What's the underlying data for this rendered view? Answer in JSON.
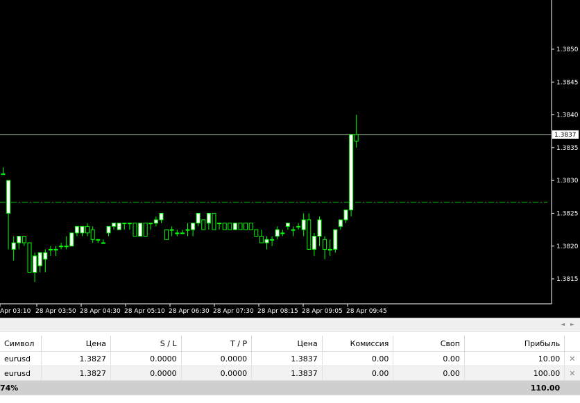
{
  "chart_data": {
    "type": "candlestick",
    "symbol": "eurusd",
    "ylim": [
      1.38112,
      1.38575
    ],
    "price_ticks": [
      "1.3815",
      "1.3820",
      "1.3825",
      "1.3830",
      "1.3835",
      "1.3840"
    ],
    "top_partial_tick": "1.3850",
    "second_tick": "1.3845",
    "current_price": "1.3837",
    "current_price_value": 1.3837,
    "open_price_value": 1.38267,
    "time_labels": [
      "Apr 03:10",
      "28 Apr 03:50",
      "28 Apr 04:30",
      "28 Apr 05:10",
      "28 Apr 06:30",
      "28 Apr 07:30",
      "28 Apr 08:15",
      "28 Apr 09:05",
      "28 Apr 09:45"
    ],
    "bull_color": "#ffffff",
    "wick_color": "#00ff00",
    "candles": [
      {
        "o": 1.3831,
        "h": 1.3832,
        "l": 1.3831,
        "c": 1.3831
      },
      {
        "o": 1.3825,
        "h": 1.383,
        "l": 1.38195,
        "c": 1.383
      },
      {
        "o": 1.38195,
        "h": 1.38215,
        "l": 1.38178,
        "c": 1.38205
      },
      {
        "o": 1.38205,
        "h": 1.38215,
        "l": 1.38195,
        "c": 1.38215
      },
      {
        "o": 1.38215,
        "h": 1.38215,
        "l": 1.382,
        "c": 1.38205
      },
      {
        "o": 1.38205,
        "h": 1.38205,
        "l": 1.3816,
        "c": 1.3816
      },
      {
        "o": 1.3816,
        "h": 1.3819,
        "l": 1.38145,
        "c": 1.38185
      },
      {
        "o": 1.3817,
        "h": 1.3819,
        "l": 1.3816,
        "c": 1.3819
      },
      {
        "o": 1.3818,
        "h": 1.38195,
        "l": 1.3816,
        "c": 1.3819
      },
      {
        "o": 1.38195,
        "h": 1.382,
        "l": 1.38185,
        "c": 1.38195
      },
      {
        "o": 1.38195,
        "h": 1.382,
        "l": 1.38185,
        "c": 1.38195
      },
      {
        "o": 1.382,
        "h": 1.38205,
        "l": 1.38195,
        "c": 1.382
      },
      {
        "o": 1.382,
        "h": 1.38215,
        "l": 1.38195,
        "c": 1.382
      },
      {
        "o": 1.382,
        "h": 1.3822,
        "l": 1.382,
        "c": 1.3822
      },
      {
        "o": 1.3822,
        "h": 1.3823,
        "l": 1.38215,
        "c": 1.3823
      },
      {
        "o": 1.3822,
        "h": 1.3823,
        "l": 1.38215,
        "c": 1.3823
      },
      {
        "o": 1.3823,
        "h": 1.38235,
        "l": 1.38215,
        "c": 1.3822
      },
      {
        "o": 1.38225,
        "h": 1.3823,
        "l": 1.38205,
        "c": 1.3821
      },
      {
        "o": 1.3821,
        "h": 1.3821,
        "l": 1.38205,
        "c": 1.3821
      },
      {
        "o": 1.38205,
        "h": 1.3821,
        "l": 1.38205,
        "c": 1.38205
      },
      {
        "o": 1.3822,
        "h": 1.38225,
        "l": 1.38215,
        "c": 1.3823
      },
      {
        "o": 1.3823,
        "h": 1.38235,
        "l": 1.38225,
        "c": 1.38235
      },
      {
        "o": 1.38225,
        "h": 1.38235,
        "l": 1.38225,
        "c": 1.38235
      },
      {
        "o": 1.38235,
        "h": 1.38235,
        "l": 1.38225,
        "c": 1.38235
      },
      {
        "o": 1.38235,
        "h": 1.38235,
        "l": 1.38225,
        "c": 1.38235
      },
      {
        "o": 1.38235,
        "h": 1.38235,
        "l": 1.38215,
        "c": 1.38215
      },
      {
        "o": 1.38215,
        "h": 1.38235,
        "l": 1.38215,
        "c": 1.38235
      },
      {
        "o": 1.38235,
        "h": 1.38235,
        "l": 1.38215,
        "c": 1.38215
      },
      {
        "o": 1.38235,
        "h": 1.38235,
        "l": 1.38225,
        "c": 1.38235
      },
      {
        "o": 1.38235,
        "h": 1.38245,
        "l": 1.3823,
        "c": 1.3824
      },
      {
        "o": 1.3824,
        "h": 1.3825,
        "l": 1.38235,
        "c": 1.3825
      },
      {
        "o": 1.38225,
        "h": 1.38225,
        "l": 1.3821,
        "c": 1.3821
      },
      {
        "o": 1.38225,
        "h": 1.3823,
        "l": 1.38215,
        "c": 1.38225
      },
      {
        "o": 1.3822,
        "h": 1.38225,
        "l": 1.38215,
        "c": 1.3822
      },
      {
        "o": 1.3822,
        "h": 1.38225,
        "l": 1.3822,
        "c": 1.3822
      },
      {
        "o": 1.38225,
        "h": 1.38235,
        "l": 1.38215,
        "c": 1.38225
      },
      {
        "o": 1.38225,
        "h": 1.38235,
        "l": 1.38215,
        "c": 1.38235
      },
      {
        "o": 1.38235,
        "h": 1.3825,
        "l": 1.3823,
        "c": 1.3825
      },
      {
        "o": 1.3824,
        "h": 1.3824,
        "l": 1.38225,
        "c": 1.38225
      },
      {
        "o": 1.38235,
        "h": 1.3825,
        "l": 1.38225,
        "c": 1.3825
      },
      {
        "o": 1.3825,
        "h": 1.3825,
        "l": 1.38225,
        "c": 1.38225
      },
      {
        "o": 1.38235,
        "h": 1.38235,
        "l": 1.38225,
        "c": 1.38235
      },
      {
        "o": 1.38235,
        "h": 1.38235,
        "l": 1.38225,
        "c": 1.38225
      },
      {
        "o": 1.38235,
        "h": 1.38235,
        "l": 1.38225,
        "c": 1.38225
      },
      {
        "o": 1.38225,
        "h": 1.38235,
        "l": 1.38225,
        "c": 1.38235
      },
      {
        "o": 1.38235,
        "h": 1.38235,
        "l": 1.38225,
        "c": 1.38225
      },
      {
        "o": 1.38235,
        "h": 1.38235,
        "l": 1.38225,
        "c": 1.38225
      },
      {
        "o": 1.38235,
        "h": 1.38235,
        "l": 1.38225,
        "c": 1.38225
      },
      {
        "o": 1.38225,
        "h": 1.38225,
        "l": 1.38215,
        "c": 1.38215
      },
      {
        "o": 1.38215,
        "h": 1.38225,
        "l": 1.38205,
        "c": 1.38205
      },
      {
        "o": 1.38205,
        "h": 1.38215,
        "l": 1.38195,
        "c": 1.3821
      },
      {
        "o": 1.3821,
        "h": 1.38215,
        "l": 1.382,
        "c": 1.3821
      },
      {
        "o": 1.38215,
        "h": 1.3823,
        "l": 1.3821,
        "c": 1.38225
      },
      {
        "o": 1.3822,
        "h": 1.38225,
        "l": 1.38215,
        "c": 1.3822
      },
      {
        "o": 1.3823,
        "h": 1.38235,
        "l": 1.38225,
        "c": 1.38235
      },
      {
        "o": 1.38225,
        "h": 1.3823,
        "l": 1.38215,
        "c": 1.38225
      },
      {
        "o": 1.3823,
        "h": 1.38235,
        "l": 1.38225,
        "c": 1.3823
      },
      {
        "o": 1.38225,
        "h": 1.3825,
        "l": 1.38215,
        "c": 1.3824
      },
      {
        "o": 1.3824,
        "h": 1.3825,
        "l": 1.38195,
        "c": 1.38195
      },
      {
        "o": 1.38195,
        "h": 1.3822,
        "l": 1.38185,
        "c": 1.38215
      },
      {
        "o": 1.38215,
        "h": 1.38245,
        "l": 1.382,
        "c": 1.3824
      },
      {
        "o": 1.3821,
        "h": 1.38215,
        "l": 1.3818,
        "c": 1.38195
      },
      {
        "o": 1.38195,
        "h": 1.3821,
        "l": 1.38185,
        "c": 1.38195
      },
      {
        "o": 1.38195,
        "h": 1.38225,
        "l": 1.3819,
        "c": 1.38225
      },
      {
        "o": 1.3823,
        "h": 1.3824,
        "l": 1.38225,
        "c": 1.3824
      },
      {
        "o": 1.3824,
        "h": 1.38245,
        "l": 1.38235,
        "c": 1.38255
      },
      {
        "o": 1.38255,
        "h": 1.3837,
        "l": 1.38245,
        "c": 1.3837
      },
      {
        "o": 1.3837,
        "h": 1.384,
        "l": 1.3835,
        "c": 1.3836
      }
    ]
  },
  "terminal": {
    "columns": [
      "Символ",
      "Цена",
      "S / L",
      "T / P",
      "Цена",
      "Комиссия",
      "Своп",
      "Прибыль"
    ],
    "rows": [
      {
        "symbol": "eurusd",
        "open_price": "1.3827",
        "sl": "0.0000",
        "tp": "0.0000",
        "price": "1.3837",
        "commission": "0.00",
        "swap": "0.00",
        "profit": "10.00"
      },
      {
        "symbol": "eurusd",
        "open_price": "1.3827",
        "sl": "0.0000",
        "tp": "0.0000",
        "price": "1.3837",
        "commission": "0.00",
        "swap": "0.00",
        "profit": "100.00"
      }
    ],
    "total_left": "74%",
    "total_profit": "110.00",
    "close_glyph": "✕",
    "left_arrow": "◄",
    "right_arrow": "►"
  }
}
